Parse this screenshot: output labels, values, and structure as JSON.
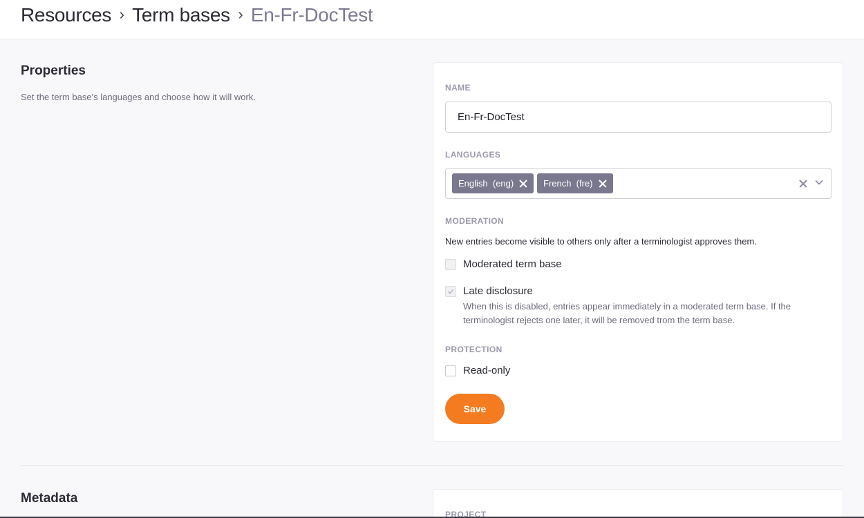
{
  "breadcrumb": {
    "items": [
      "Resources",
      "Term bases"
    ],
    "separator": "›",
    "current": "En-Fr-DocTest"
  },
  "properties": {
    "title": "Properties",
    "description": "Set the term base's languages and choose how it will work."
  },
  "form": {
    "name_label": "NAME",
    "name_value": "En-Fr-DocTest",
    "languages_label": "LANGUAGES",
    "languages": [
      "English  (eng)",
      "French  (fre)"
    ],
    "moderation_label": "MODERATION",
    "moderation_description": "New entries become visible to others only after a terminologist approves them.",
    "moderated": {
      "label": "Moderated term base",
      "checked": false,
      "disabled": true
    },
    "late_disclosure": {
      "label": "Late disclosure",
      "checked": true,
      "disabled": true,
      "help": "When this is disabled, entries appear immediately in a moderated term base. If the terminologist rejects one later, it will be removed trom the term base."
    },
    "protection_label": "PROTECTION",
    "read_only": {
      "label": "Read-only",
      "checked": false,
      "disabled": false
    },
    "save_label": "Save"
  },
  "metadata": {
    "title": "Metadata",
    "project_label": "PROJECT"
  },
  "colors": {
    "accent": "#f47b20",
    "tag_background": "#7a788e",
    "label_muted": "#9b99ad",
    "page_background": "#f8f8fb"
  },
  "icons": {
    "tag_remove": "close-icon",
    "clear_all": "close-icon",
    "dropdown": "chevron-down-icon",
    "checked": "checkmark-icon"
  }
}
